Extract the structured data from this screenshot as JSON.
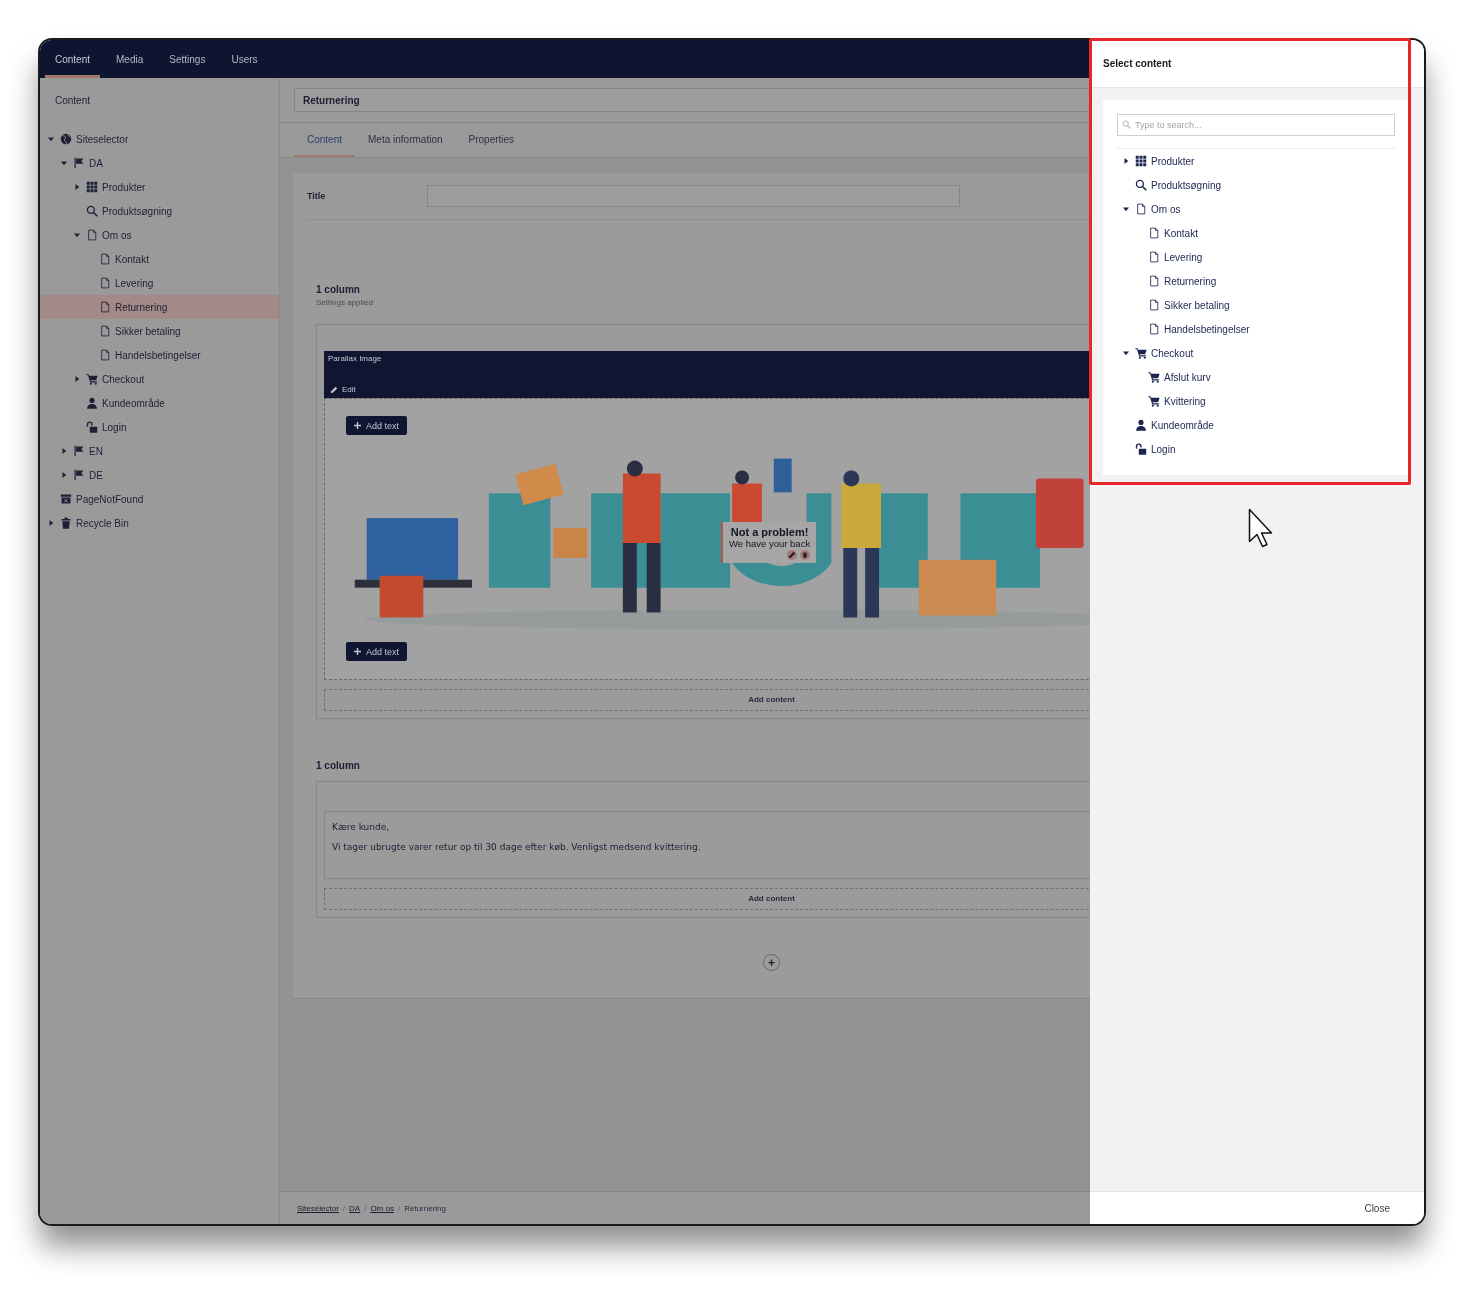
{
  "nav": {
    "tabs": [
      {
        "label": "Content",
        "selected": true
      },
      {
        "label": "Media",
        "selected": false
      },
      {
        "label": "Settings",
        "selected": false
      },
      {
        "label": "Users",
        "selected": false
      }
    ]
  },
  "sidebar": {
    "title": "Content",
    "tree": [
      {
        "label": "Siteselector",
        "kind": "globe",
        "expanded": true,
        "selected": false,
        "children": [
          {
            "label": "DA",
            "kind": "flag",
            "expanded": true,
            "selected": false,
            "children": [
              {
                "label": "Produkter",
                "kind": "grid",
                "expanded": false,
                "selected": false
              },
              {
                "label": "Produktsøgning",
                "kind": "search",
                "selected": false
              },
              {
                "label": "Om os",
                "kind": "page",
                "expanded": true,
                "selected": false,
                "children": [
                  {
                    "label": "Kontakt",
                    "kind": "page",
                    "selected": false
                  },
                  {
                    "label": "Levering",
                    "kind": "page",
                    "selected": false
                  },
                  {
                    "label": "Returnering",
                    "kind": "page",
                    "selected": true
                  },
                  {
                    "label": "Sikker betaling",
                    "kind": "page",
                    "selected": false
                  },
                  {
                    "label": "Handelsbetingelser",
                    "kind": "page",
                    "selected": false
                  }
                ]
              },
              {
                "label": "Checkout",
                "kind": "cart",
                "expanded": false,
                "selected": false
              },
              {
                "label": "Kundeområde",
                "kind": "user",
                "selected": false
              },
              {
                "label": "Login",
                "kind": "lock",
                "selected": false
              }
            ]
          },
          {
            "label": "EN",
            "kind": "flag",
            "expanded": false,
            "selected": false
          },
          {
            "label": "DE",
            "kind": "flag",
            "expanded": false,
            "selected": false
          }
        ]
      },
      {
        "label": "PageNotFound",
        "kind": "archive",
        "selected": false
      },
      {
        "label": "Recycle Bin",
        "kind": "trash",
        "expanded": false,
        "selected": false
      }
    ]
  },
  "editor": {
    "name": "Returnering",
    "tabs": [
      {
        "label": "Content",
        "selected": true
      },
      {
        "label": "Meta information",
        "selected": false
      },
      {
        "label": "Properties",
        "selected": false
      }
    ],
    "title_field": {
      "label": "Title"
    },
    "sections": [
      {
        "kind": "parallax",
        "heading": "1 column",
        "note": "Settings applied",
        "block_title": "Parallax Image",
        "edit_label": "Edit",
        "add_text": [
          "Add text",
          "Add text"
        ],
        "caption": {
          "heading": "Not a problem!",
          "text": "We have your back"
        },
        "add_content": "Add content"
      },
      {
        "kind": "text",
        "heading": "1 column",
        "lines": [
          "Kære kunde,",
          "Vi tager ubrugte varer retur op til 30 dage efter køb. Venligst medsend kvittering."
        ],
        "add_content": "Add content"
      }
    ],
    "add_row": "+"
  },
  "breadcrumb": {
    "separator": "/",
    "items": [
      {
        "label": "Siteselector",
        "link": true
      },
      {
        "label": "DA",
        "link": true
      },
      {
        "label": "Om os",
        "link": true
      },
      {
        "label": "Returnering",
        "link": false
      }
    ]
  },
  "picker": {
    "title": "Select content",
    "search": {
      "placeholder": "Type to search..."
    },
    "tree": [
      {
        "label": "Produkter",
        "kind": "grid",
        "expanded": false
      },
      {
        "label": "Produktsøgning",
        "kind": "search"
      },
      {
        "label": "Om os",
        "kind": "page",
        "expanded": true,
        "children": [
          {
            "label": "Kontakt",
            "kind": "page"
          },
          {
            "label": "Levering",
            "kind": "page"
          },
          {
            "label": "Returnering",
            "kind": "page"
          },
          {
            "label": "Sikker betaling",
            "kind": "page"
          },
          {
            "label": "Handelsbetingelser",
            "kind": "page"
          }
        ]
      },
      {
        "label": "Checkout",
        "kind": "cart",
        "expanded": true,
        "children": [
          {
            "label": "Afslut kurv",
            "kind": "cart"
          },
          {
            "label": "Kvittering",
            "kind": "cart"
          }
        ]
      },
      {
        "label": "Kundeområde",
        "kind": "user"
      },
      {
        "label": "Login",
        "kind": "lock"
      }
    ],
    "close": "Close"
  }
}
